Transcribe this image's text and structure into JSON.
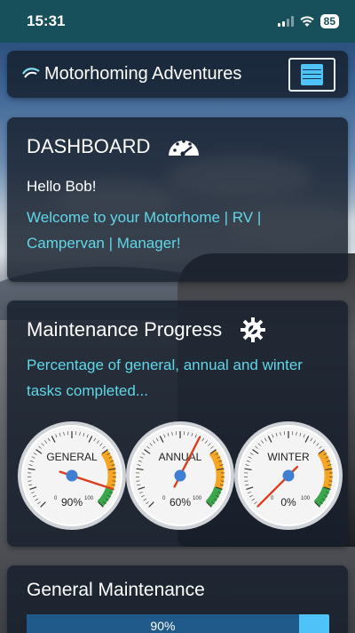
{
  "status_bar": {
    "time": "15:31",
    "battery": "85"
  },
  "header": {
    "title": "Motorhoming Adventures",
    "menu_icon": "hamburger-menu-icon"
  },
  "dashboard": {
    "title": "DASHBOARD",
    "icon": "speedometer-icon",
    "greeting": "Hello Bob!",
    "welcome": "Welcome to your Motorhome | RV | Campervan | Manager!"
  },
  "maintenance": {
    "title": "Maintenance Progress",
    "icon": "gear-wrench-icon",
    "description": "Percentage of general, annual and winter tasks completed...",
    "gauges": [
      {
        "label": "GENERAL",
        "value": 90,
        "display": "90%",
        "min_label": "0",
        "max_label": "100"
      },
      {
        "label": "ANNUAL",
        "value": 60,
        "display": "60%",
        "min_label": "0",
        "max_label": "100"
      },
      {
        "label": "WINTER",
        "value": 0,
        "display": "0%",
        "min_label": "0",
        "max_label": "100"
      }
    ],
    "colors": {
      "orange": "#f5a623",
      "green": "#3aa84a",
      "needle": "#d9401f",
      "hub": "#3f7fd1"
    }
  },
  "general_maintenance": {
    "title": "General Maintenance",
    "progress": 90,
    "progress_label": "90%"
  },
  "colors": {
    "accent": "#5fd7e8",
    "menu": "#4fc3f7",
    "progress_fill": "#1f5a8a",
    "progress_track": "#4fc3f7"
  }
}
